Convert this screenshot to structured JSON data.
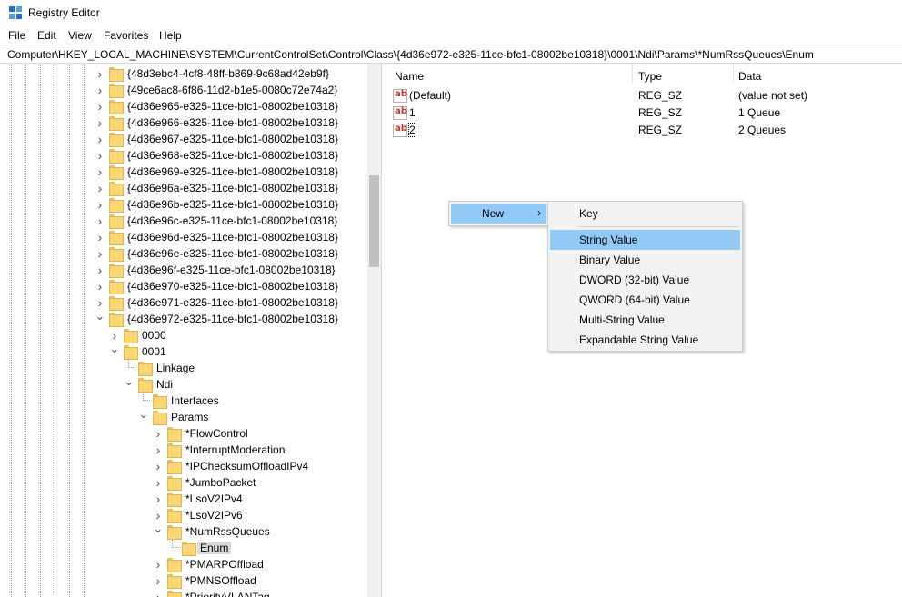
{
  "window": {
    "title": "Registry Editor",
    "icon": "regedit-icon"
  },
  "menubar": {
    "items": [
      "File",
      "Edit",
      "View",
      "Favorites",
      "Help"
    ]
  },
  "address": {
    "path": "Computer\\HKEY_LOCAL_MACHINE\\SYSTEM\\CurrentControlSet\\Control\\Class\\{4d36e972-e325-11ce-bfc1-08002be10318}\\0001\\Ndi\\Params\\*NumRssQueues\\Enum"
  },
  "tree": {
    "nodes": [
      {
        "label": "{48d3ebc4-4cf8-48ff-b869-9c68ad42eb9f}",
        "expander": "collapsed"
      },
      {
        "label": "{49ce6ac8-6f86-11d2-b1e5-0080c72e74a2}",
        "expander": "collapsed"
      },
      {
        "label": "{4d36e965-e325-11ce-bfc1-08002be10318}",
        "expander": "collapsed"
      },
      {
        "label": "{4d36e966-e325-11ce-bfc1-08002be10318}",
        "expander": "collapsed"
      },
      {
        "label": "{4d36e967-e325-11ce-bfc1-08002be10318}",
        "expander": "collapsed"
      },
      {
        "label": "{4d36e968-e325-11ce-bfc1-08002be10318}",
        "expander": "collapsed"
      },
      {
        "label": "{4d36e969-e325-11ce-bfc1-08002be10318}",
        "expander": "collapsed"
      },
      {
        "label": "{4d36e96a-e325-11ce-bfc1-08002be10318}",
        "expander": "collapsed"
      },
      {
        "label": "{4d36e96b-e325-11ce-bfc1-08002be10318}",
        "expander": "collapsed"
      },
      {
        "label": "{4d36e96c-e325-11ce-bfc1-08002be10318}",
        "expander": "collapsed"
      },
      {
        "label": "{4d36e96d-e325-11ce-bfc1-08002be10318}",
        "expander": "collapsed"
      },
      {
        "label": "{4d36e96e-e325-11ce-bfc1-08002be10318}",
        "expander": "collapsed"
      },
      {
        "label": "{4d36e96f-e325-11ce-bfc1-08002be10318}",
        "expander": "collapsed"
      },
      {
        "label": "{4d36e970-e325-11ce-bfc1-08002be10318}",
        "expander": "collapsed"
      },
      {
        "label": "{4d36e971-e325-11ce-bfc1-08002be10318}",
        "expander": "collapsed"
      },
      {
        "label": "{4d36e972-e325-11ce-bfc1-08002be10318}",
        "expander": "expanded"
      },
      {
        "label": "0000",
        "expander": "collapsed"
      },
      {
        "label": "0001",
        "expander": "expanded"
      },
      {
        "label": "Linkage",
        "expander": "none"
      },
      {
        "label": "Ndi",
        "expander": "expanded"
      },
      {
        "label": "Interfaces",
        "expander": "none"
      },
      {
        "label": "Params",
        "expander": "expanded"
      },
      {
        "label": "*FlowControl",
        "expander": "collapsed"
      },
      {
        "label": "*InterruptModeration",
        "expander": "collapsed"
      },
      {
        "label": "*IPChecksumOffloadIPv4",
        "expander": "collapsed"
      },
      {
        "label": "*JumboPacket",
        "expander": "collapsed"
      },
      {
        "label": "*LsoV2IPv4",
        "expander": "collapsed"
      },
      {
        "label": "*LsoV2IPv6",
        "expander": "collapsed"
      },
      {
        "label": "*NumRssQueues",
        "expander": "expanded"
      },
      {
        "label": "Enum",
        "expander": "none",
        "selected": true
      },
      {
        "label": "*PMARPOffload",
        "expander": "collapsed"
      },
      {
        "label": "*PMNSOffload",
        "expander": "collapsed"
      },
      {
        "label": "*PriorityVLANTag",
        "expander": "collapsed"
      }
    ]
  },
  "list": {
    "columns": {
      "name": "Name",
      "type": "Type",
      "data": "Data"
    },
    "rows": [
      {
        "name": "(Default)",
        "type": "REG_SZ",
        "data": "(value not set)",
        "icon": "string-value-icon"
      },
      {
        "name": "1",
        "type": "REG_SZ",
        "data": "1 Queue",
        "icon": "string-value-icon"
      },
      {
        "name": "2",
        "type": "REG_SZ",
        "data": "2 Queues",
        "icon": "string-value-icon"
      }
    ]
  },
  "context_menu": {
    "new_label": "New",
    "submenu": [
      {
        "label": "Key"
      },
      {
        "label": "String Value",
        "highlighted": true
      },
      {
        "label": "Binary Value"
      },
      {
        "label": "DWORD (32-bit) Value"
      },
      {
        "label": "QWORD (64-bit) Value"
      },
      {
        "label": "Multi-String Value"
      },
      {
        "label": "Expandable String Value"
      }
    ]
  },
  "colors": {
    "menu_highlight": "#91c9f7",
    "folder": "#f8d775",
    "selection_gray": "#d9d9d9"
  }
}
